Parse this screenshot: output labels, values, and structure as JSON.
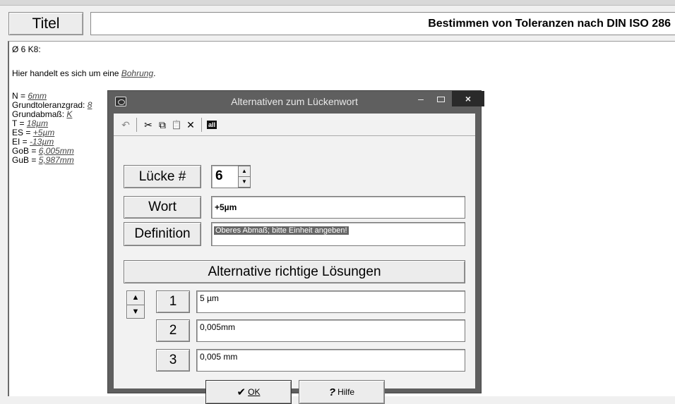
{
  "header": {
    "titel_button": "Titel",
    "title_value": "Bestimmen von Toleranzen nach DIN ISO 286"
  },
  "document": {
    "line1": "Ø 6 K8:",
    "intro_prefix": "Hier handelt es sich um eine ",
    "intro_link": "Bohrung",
    "intro_suffix": ".",
    "fields": [
      {
        "label": "N = ",
        "value": "6mm"
      },
      {
        "label": "Grundtoleranzgrad: ",
        "value": "8"
      },
      {
        "label": "Grundabmaß: ",
        "value": "K"
      },
      {
        "label": "T = ",
        "value": "18µm"
      },
      {
        "label": "ES = ",
        "value": "+5µm"
      },
      {
        "label": "EI = ",
        "value": "-13µm"
      },
      {
        "label": "GoB = ",
        "value": "6,005mm"
      },
      {
        "label": "GuB = ",
        "value": "5,987mm"
      }
    ]
  },
  "dialog": {
    "title": "Alternativen zum Lückenwort",
    "window_controls": {
      "minimize": "–",
      "close": "×"
    },
    "toolbar": {
      "undo_icon": "↶",
      "cut_icon": "✂",
      "copy_icon": "⧉",
      "paste_icon": "📋",
      "delete_icon": "✕",
      "all_label": "all"
    },
    "luecke_label": "Lücke #",
    "luecke_value": "6",
    "wort_label": "Wort",
    "wort_value": "+5µm",
    "definition_label": "Definition",
    "definition_value": "Oberes Abmaß; bitte Einheit angeben!",
    "alternatives_header": "Alternative richtige Lösungen",
    "alternatives": [
      {
        "num": "1",
        "value": "5 µm"
      },
      {
        "num": "2",
        "value": "0,005mm"
      },
      {
        "num": "3",
        "value": "0,005 mm"
      }
    ],
    "ok_icon": "✔",
    "ok_label": "OK",
    "help_icon": "?",
    "help_label": "Hilfe"
  }
}
